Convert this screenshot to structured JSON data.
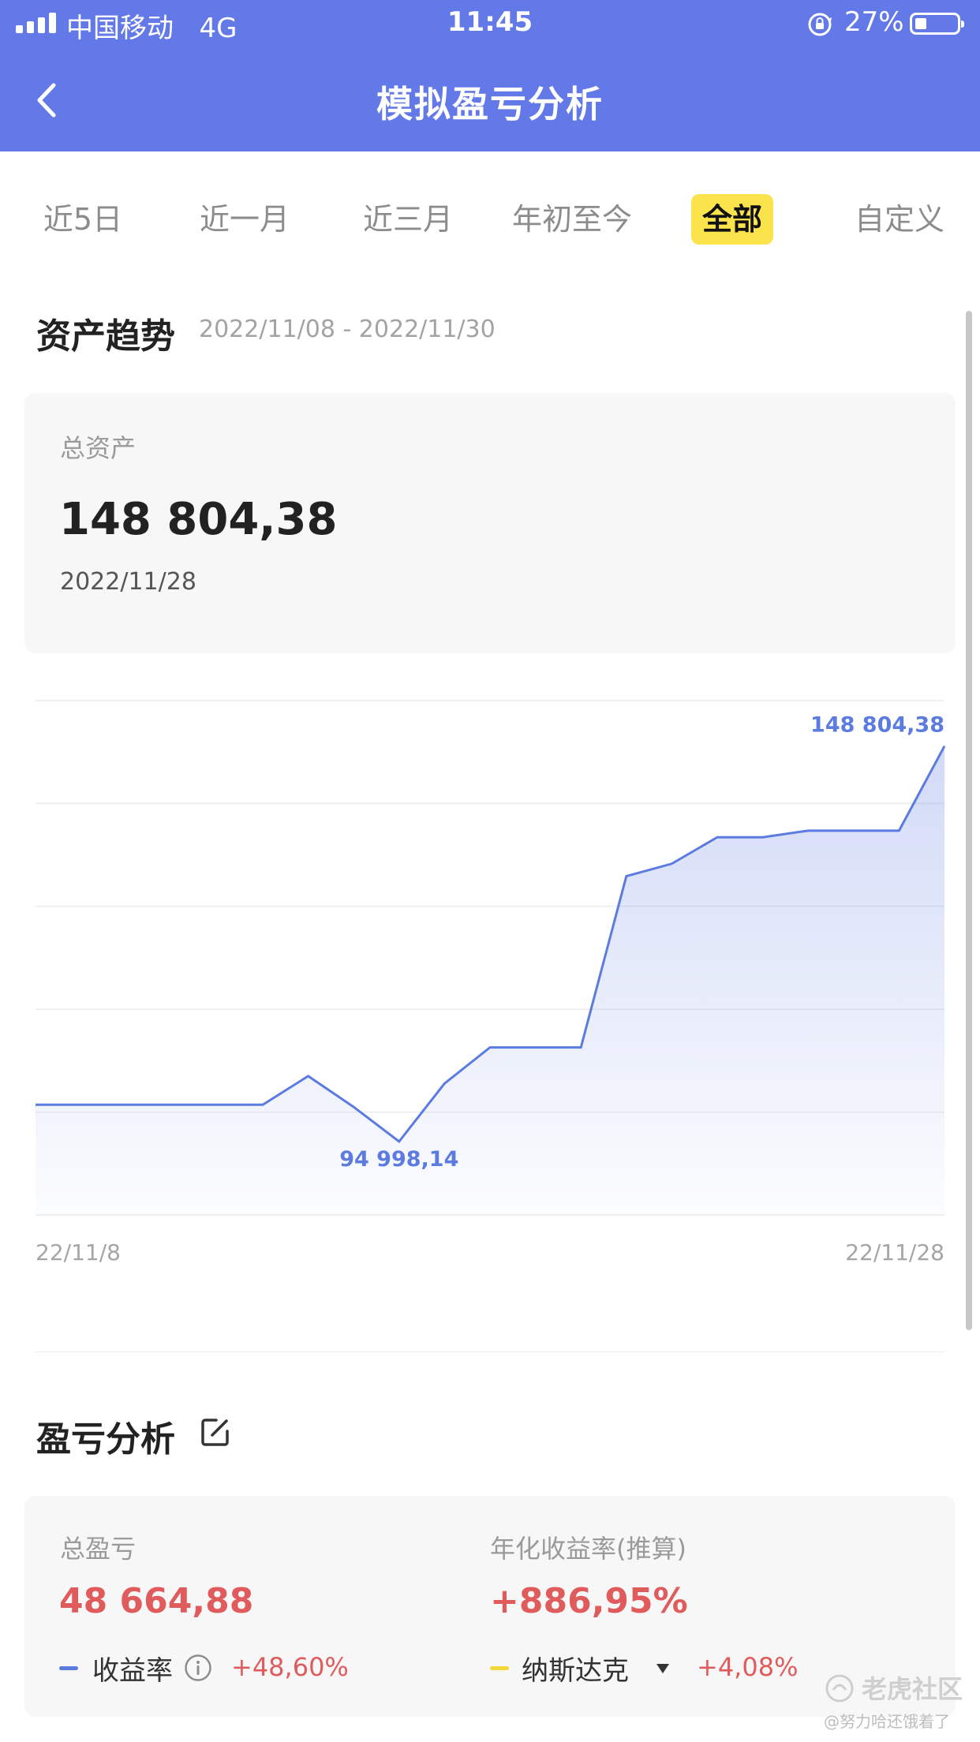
{
  "status_bar": {
    "carrier": "中国移动",
    "network": "4G",
    "time": "11:45",
    "battery_pct": "27%",
    "battery_level": 0.27
  },
  "nav": {
    "title": "模拟盈亏分析"
  },
  "tabs": [
    {
      "label": "近5日",
      "active": false
    },
    {
      "label": "近一月",
      "active": false
    },
    {
      "label": "近三月",
      "active": false
    },
    {
      "label": "年初至今",
      "active": false
    },
    {
      "label": "全部",
      "active": true
    },
    {
      "label": "自定义",
      "active": false
    }
  ],
  "asset_trend": {
    "title": "资产趋势",
    "date_range": "2022/11/08 - 2022/11/30",
    "card": {
      "label": "总资产",
      "value": "148 804,38",
      "date": "2022/11/28"
    }
  },
  "chart_data": {
    "type": "area",
    "x_start_label": "22/11/8",
    "x_end_label": "22/11/28",
    "max_label": "148 804,38",
    "min_label": "94 998,14",
    "x": [
      0,
      1,
      2,
      3,
      4,
      5,
      6,
      7,
      8,
      9,
      10,
      11,
      12,
      13,
      14,
      15,
      16,
      17,
      18,
      19,
      20
    ],
    "values": [
      100000,
      100000,
      100000,
      100000,
      100000,
      100000,
      103900,
      99700,
      94998.14,
      102900,
      107800,
      107800,
      107800,
      131100,
      132800,
      136400,
      136400,
      137300,
      137300,
      137300,
      148804.38
    ],
    "ylim": [
      85000,
      155000
    ],
    "grid": true,
    "line_color": "#5c7be0"
  },
  "pnl": {
    "title": "盈亏分析",
    "total_label": "总盈亏",
    "total_value": "48 664,88",
    "annual_label": "年化收益率(推算)",
    "annual_value": "+886,95%",
    "legend_return_label": "收益率",
    "legend_return_value": "+48,60%",
    "legend_return_color": "#5c7be0",
    "legend_bench_label": "纳斯达克",
    "legend_bench_value": "+4,08%",
    "legend_bench_color": "#f4d73b"
  },
  "watermark": {
    "line1": "老虎社区",
    "line2": "@努力哈还饿着了"
  }
}
